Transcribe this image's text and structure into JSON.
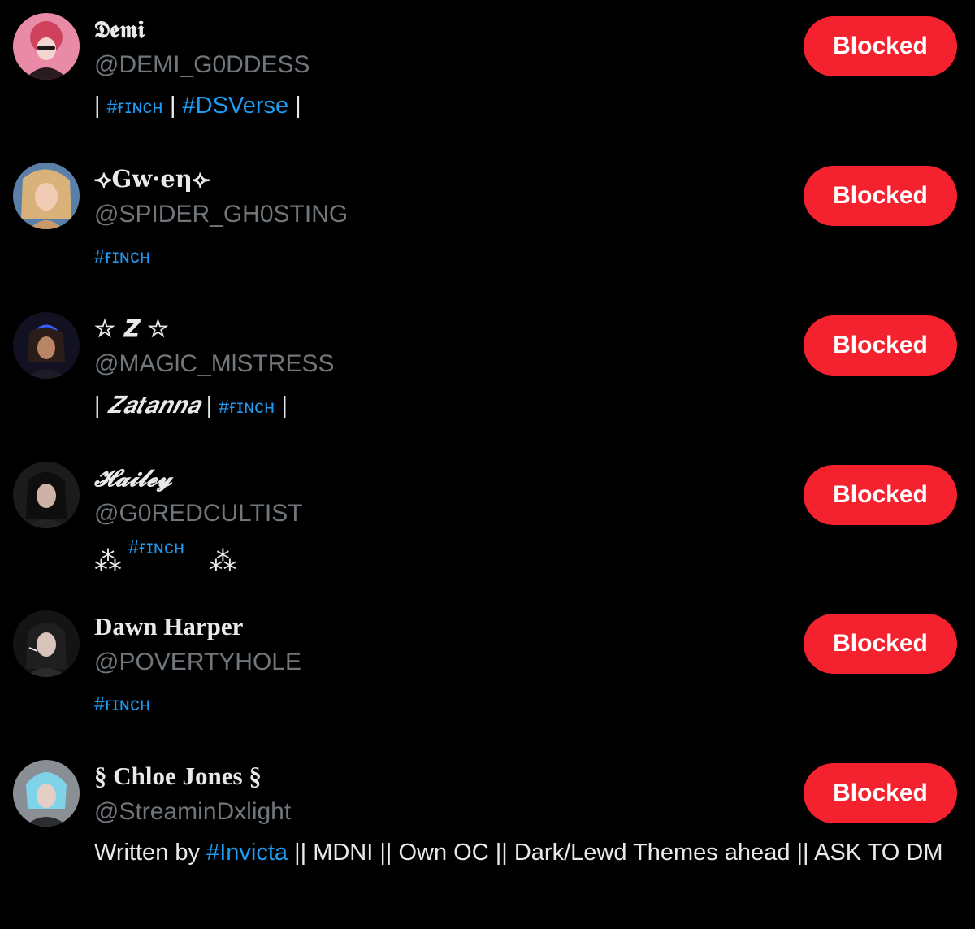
{
  "colors": {
    "background": "#000000",
    "text": "#e7e9ea",
    "muted": "#71767b",
    "link": "#1d9bf0",
    "blocked_button": "#f4212e"
  },
  "users": [
    {
      "name": "𝕯𝖊𝖒𝖎",
      "handle": "@DEMI_G0DDESS",
      "button": "Blocked",
      "bio": {
        "sep1": "| ",
        "tag1": "#ғɪɴᴄʜ",
        "sep2": " | ",
        "tag2": "#DSVerse",
        "sep3": " |"
      }
    },
    {
      "name": "⟢Gw·eη⟣",
      "handle": "@SPIDER_GH0STING",
      "button": "Blocked",
      "bio": {
        "tag1": "#ғɪɴᴄʜ"
      }
    },
    {
      "name": "☆ 𝒁 ☆",
      "handle": "@MAGlC_MlSTRESS",
      "button": "Blocked",
      "bio": {
        "sep1": "| ",
        "text": "𝒁𝒂𝒕𝒂𝒏𝒏𝒂",
        "sep2": " | ",
        "tag1": "#ғɪɴᴄʜ",
        "sep3": " |"
      }
    },
    {
      "name": "𝓗𝓪𝓲𝓵𝓮𝔂",
      "handle": "@G0REDCULTIST",
      "button": "Blocked",
      "bio": {
        "deco1": "⁂",
        "tag1": "#ғɪɴᴄʜ",
        "deco2": "⁂"
      }
    },
    {
      "name": "Dawn Harper",
      "handle": "@POVERTYHOLE",
      "button": "Blocked",
      "bio": {
        "tag1": "#ғɪɴᴄʜ"
      }
    },
    {
      "name": "§ Chloe Jones §",
      "handle": "@StreaminDxlight",
      "button": "Blocked",
      "bio": {
        "text1": "Written by ",
        "tag1": "#Invicta",
        "text2": " || MDNI || Own OC || Dark/Lewd Themes ahead || ASK TO DM"
      }
    }
  ]
}
